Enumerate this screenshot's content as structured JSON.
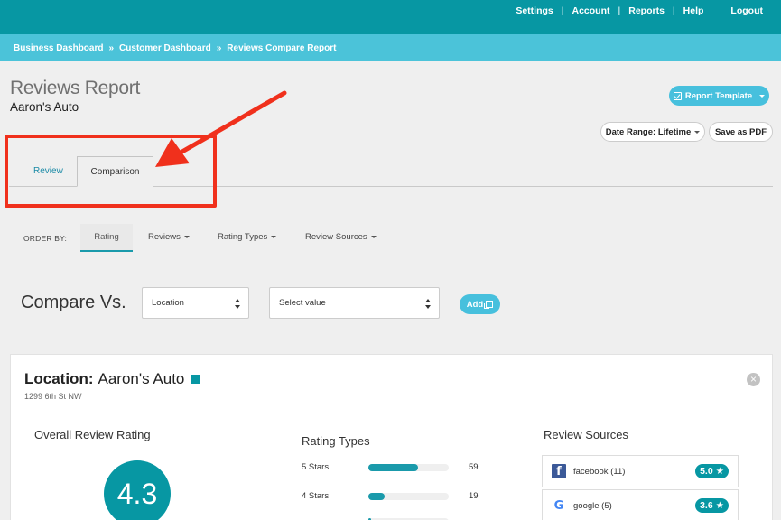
{
  "topnav": {
    "items": [
      "Settings",
      "Account",
      "Reports",
      "Help"
    ],
    "logout": "Logout"
  },
  "breadcrumb": [
    "Business Dashboard",
    "Customer Dashboard",
    "Reviews Compare Report"
  ],
  "breadcrumb_sep": "»",
  "page": {
    "title": "Reviews Report",
    "subtitle": "Aaron's Auto"
  },
  "actions": {
    "report_template": "Report Template",
    "date_range": "Date Range: Lifetime",
    "save_pdf": "Save as PDF"
  },
  "tabs": {
    "review": "Review",
    "comparison": "Comparison",
    "active": "Comparison"
  },
  "order_by": {
    "label": "ORDER BY:",
    "options": [
      "Rating",
      "Reviews",
      "Rating Types",
      "Review Sources"
    ],
    "active": "Rating"
  },
  "compare": {
    "label": "Compare Vs.",
    "type_value": "Location",
    "value_placeholder": "Select value",
    "add_label": "Add"
  },
  "card": {
    "label": "Location:",
    "name": "Aaron's Auto",
    "address": "1299 6th St NW",
    "accent_color": "#0797a3",
    "overall": {
      "title": "Overall Review Rating",
      "value": "4.3"
    },
    "rating_types": {
      "title": "Rating Types",
      "rows": [
        {
          "label": "5 Stars",
          "count": "59",
          "fill": 0.62
        },
        {
          "label": "4 Stars",
          "count": "19",
          "fill": 0.2
        }
      ]
    },
    "review_sources": {
      "title": "Review Sources",
      "rows": [
        {
          "label": "facebook (11)",
          "score": "5.0 ★",
          "icon": "facebook-icon"
        },
        {
          "label": "google (5)",
          "score": "3.6 ★",
          "icon": "google-icon"
        }
      ]
    }
  }
}
